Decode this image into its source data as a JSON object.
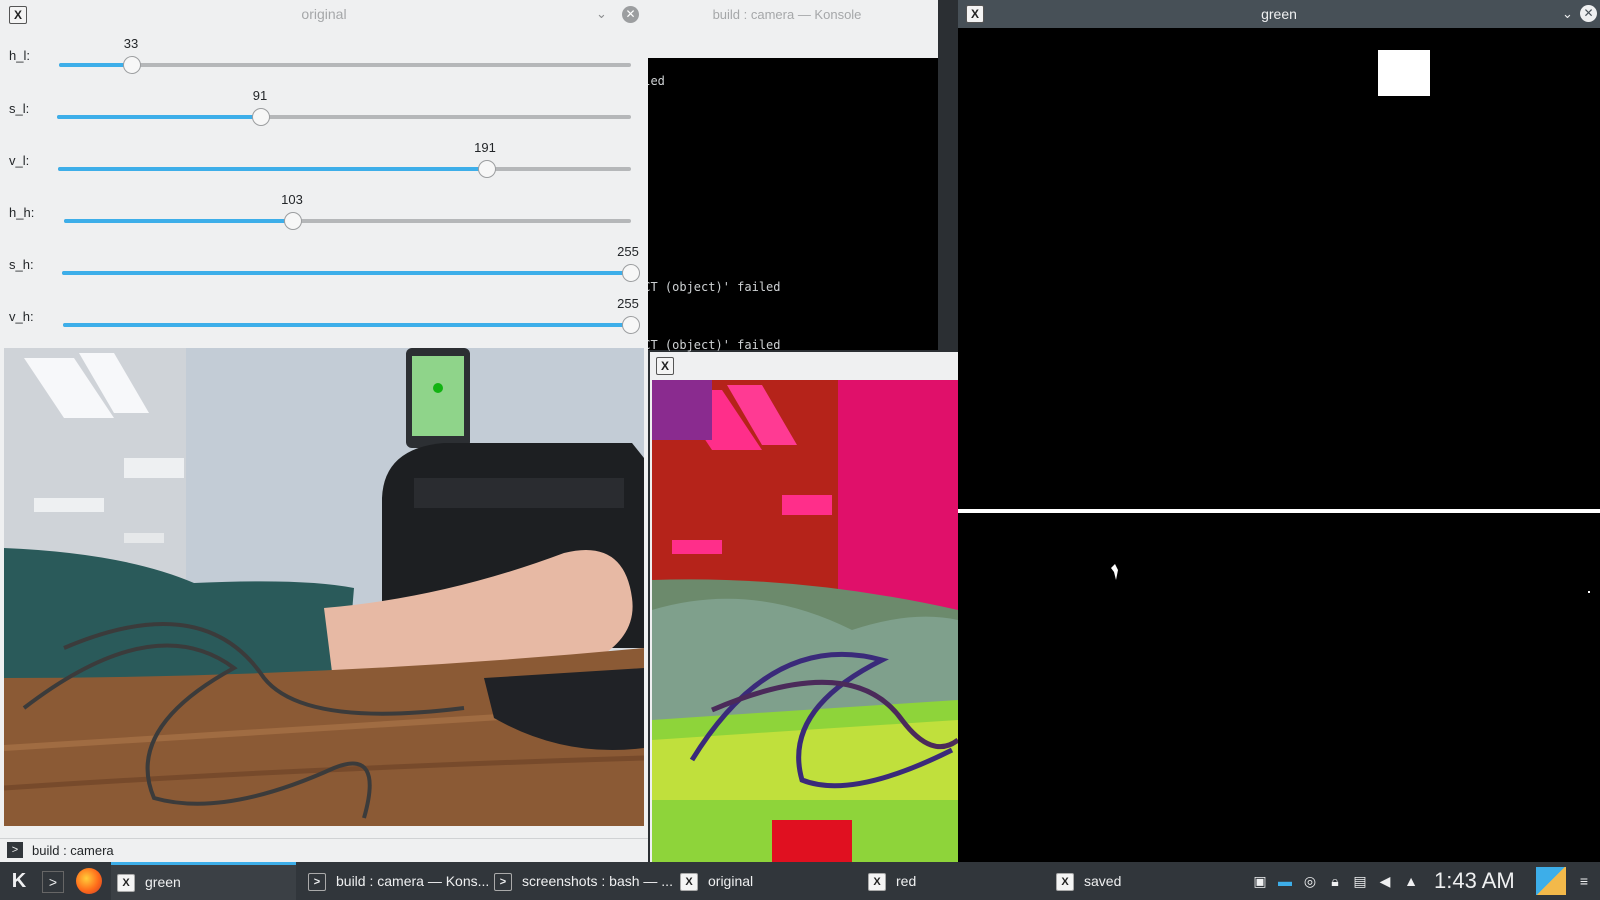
{
  "konsole": {
    "title": "build : camera — Konsole",
    "lines": [
      "iled",
      "ECT (object)' failed",
      "ECT (object)' failed"
    ]
  },
  "original": {
    "title": "original",
    "sliders": [
      {
        "label": "h_l:",
        "value": "33",
        "fraction": 0.129
      },
      {
        "label": "s_l:",
        "value": "91",
        "fraction": 0.357
      },
      {
        "label": "v_l:",
        "value": "191",
        "fraction": 0.749
      },
      {
        "label": "h_h:",
        "value": "103",
        "fraction": 0.404
      },
      {
        "label": "s_h:",
        "value": "255",
        "fraction": 1.0
      },
      {
        "label": "v_h:",
        "value": "255",
        "fraction": 1.0
      }
    ]
  },
  "statusline": {
    "label": "build : camera"
  },
  "green": {
    "title": "green"
  },
  "taskbar": {
    "tasks": [
      "green",
      "build : camera — Kons...",
      "screenshots : bash — ...",
      "original",
      "red",
      "saved"
    ],
    "clock": "1:43 AM"
  },
  "colors": {
    "accent": "#3daee9",
    "titlebar_active": "#475057",
    "panel": "#31363b",
    "window_bg": "#eff0f1"
  }
}
